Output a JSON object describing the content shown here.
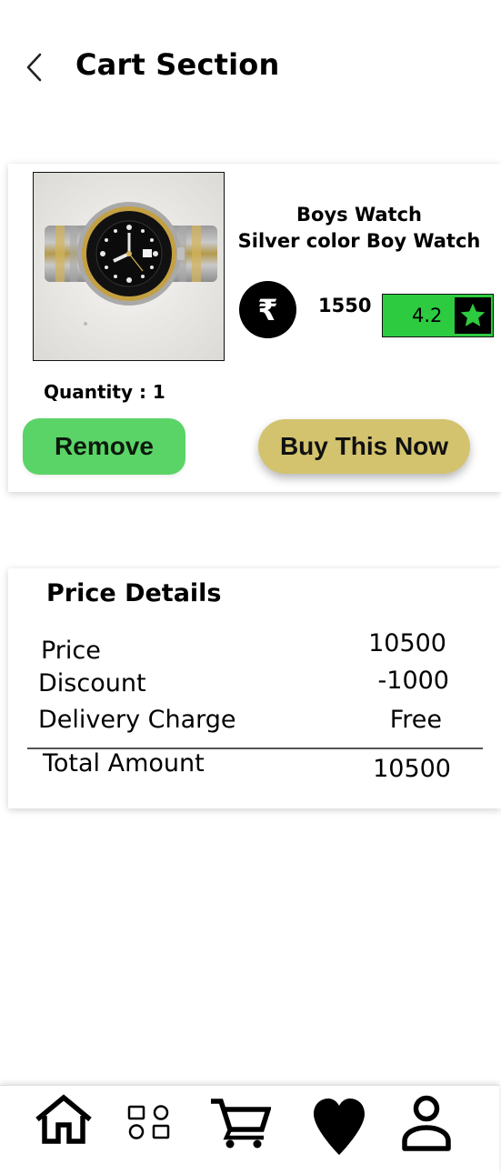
{
  "header": {
    "title": "Cart Section",
    "back_icon": "chevron-left-icon"
  },
  "cart_item": {
    "name_line1": "Boys Watch",
    "name_line2": "Silver color Boy Watch",
    "currency_icon": "rupee-icon",
    "currency_symbol": "₹",
    "price": "1550",
    "rating": "4.2",
    "rating_icon": "star-icon",
    "quantity_label": "Quantity : 1",
    "remove_label": "Remove",
    "buy_label": "Buy This Now",
    "colors": {
      "remove": "#5bd467",
      "buy": "#d3c36e",
      "rating": "#2dcb3f"
    }
  },
  "price_details": {
    "title": "Price Details",
    "rows": [
      {
        "label": "Price",
        "value": "10500"
      },
      {
        "label": "Discount",
        "value": "-1000"
      },
      {
        "label": "Delivery Charge",
        "value": "Free"
      }
    ],
    "total_label": "Total Amount",
    "total_value": "10500"
  },
  "bottom_nav": {
    "items": [
      {
        "icon": "home-icon"
      },
      {
        "icon": "categories-icon"
      },
      {
        "icon": "cart-icon"
      },
      {
        "icon": "wishlist-heart-icon"
      },
      {
        "icon": "profile-icon"
      }
    ]
  }
}
